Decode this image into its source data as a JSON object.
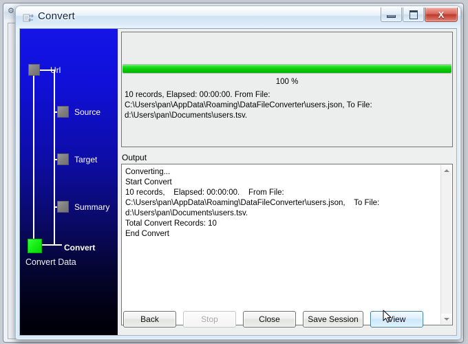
{
  "window": {
    "title": "Convert",
    "app_icon": "convert-app-icon",
    "controls": {
      "minimize": "minimize-button",
      "maximize": "maximize-button",
      "close_glyph": "X"
    }
  },
  "sidebar": {
    "steps": [
      {
        "label": "Url",
        "state": "done",
        "node": "url-node"
      },
      {
        "label": "Source",
        "state": "done",
        "node": "source-node"
      },
      {
        "label": "Target",
        "state": "done",
        "node": "target-node"
      },
      {
        "label": "Summary",
        "state": "done",
        "node": "summary-node"
      },
      {
        "label": "Convert",
        "state": "active",
        "node": "convert-node"
      }
    ],
    "footer_label": "Convert Data",
    "colors": {
      "background_top": "#1414e8",
      "background_bottom": "#000008",
      "node_inactive": "#808080",
      "node_active": "#13ee13"
    }
  },
  "status": {
    "progress_percent": 100,
    "progress_label": "100 %",
    "progress_color": "#09cc09",
    "summary_line1": "10 records,   Elapsed: 00:00:00.   From File:",
    "summary_line2": "C:\\Users\\pan\\AppData\\Roaming\\DataFileConverter\\users.json,   To File:",
    "summary_line3": "d:\\Users\\pan\\Documents\\users.tsv."
  },
  "output": {
    "label": "Output",
    "log": "Converting...\nStart Convert\n10 records,    Elapsed: 00:00:00.    From File: C:\\Users\\pan\\AppData\\Roaming\\DataFileConverter\\users.json,    To File: d:\\Users\\pan\\Documents\\users.tsv.\nTotal Convert Records: 10\nEnd Convert",
    "scrollbar": {
      "up": "scroll-up-arrow",
      "down": "scroll-down-arrow"
    }
  },
  "buttons": {
    "back": "Back",
    "stop": "Stop",
    "close": "Close",
    "save_session": "Save Session",
    "view": "View"
  }
}
